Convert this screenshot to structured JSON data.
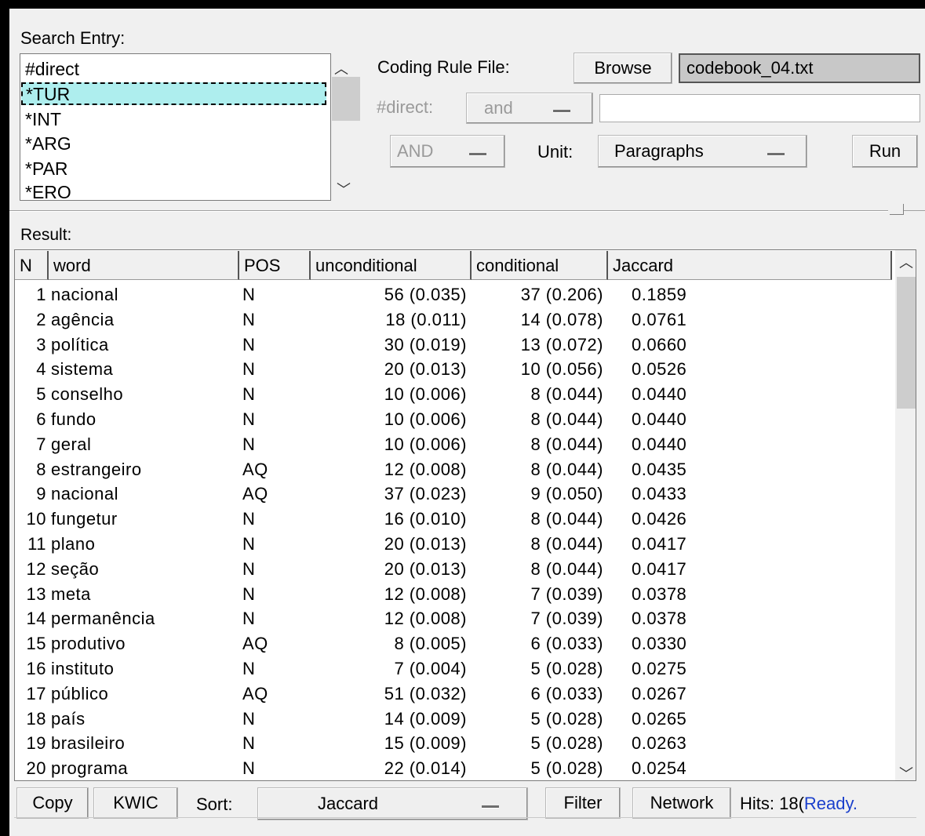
{
  "search": {
    "label": "Search Entry:",
    "entries": [
      "#direct",
      "*TUR",
      "*INT",
      "*ARG",
      "*PAR",
      "*ERO"
    ],
    "selected_index": 1
  },
  "coding": {
    "label": "Coding Rule File:",
    "browse_label": "Browse",
    "file_value": "codebook_04.txt"
  },
  "direct": {
    "label": "#direct:",
    "operator": "and",
    "value": ""
  },
  "options": {
    "logic": "AND",
    "unit_label": "Unit:",
    "unit_value": "Paragraphs",
    "run_label": "Run"
  },
  "result": {
    "label": "Result:",
    "columns": [
      "N",
      "word",
      "POS",
      "unconditional",
      "conditional",
      "Jaccard"
    ],
    "rows": [
      [
        "1",
        "nacional",
        "N",
        "56 (0.035)",
        "37 (0.206)",
        "0.1859"
      ],
      [
        "2",
        "agência",
        "N",
        "18 (0.011)",
        "14 (0.078)",
        "0.0761"
      ],
      [
        "3",
        "política",
        "N",
        "30 (0.019)",
        "13 (0.072)",
        "0.0660"
      ],
      [
        "4",
        "sistema",
        "N",
        "20 (0.013)",
        "10 (0.056)",
        "0.0526"
      ],
      [
        "5",
        "conselho",
        "N",
        "10 (0.006)",
        "8 (0.044)",
        "0.0440"
      ],
      [
        "6",
        "fundo",
        "N",
        "10 (0.006)",
        "8 (0.044)",
        "0.0440"
      ],
      [
        "7",
        "geral",
        "N",
        "10 (0.006)",
        "8 (0.044)",
        "0.0440"
      ],
      [
        "8",
        "estrangeiro",
        "AQ",
        "12 (0.008)",
        "8 (0.044)",
        "0.0435"
      ],
      [
        "9",
        "nacional",
        "AQ",
        "37 (0.023)",
        "9 (0.050)",
        "0.0433"
      ],
      [
        "10",
        "fungetur",
        "N",
        "16 (0.010)",
        "8 (0.044)",
        "0.0426"
      ],
      [
        "11",
        "plano",
        "N",
        "20 (0.013)",
        "8 (0.044)",
        "0.0417"
      ],
      [
        "12",
        "seção",
        "N",
        "20 (0.013)",
        "8 (0.044)",
        "0.0417"
      ],
      [
        "13",
        "meta",
        "N",
        "12 (0.008)",
        "7 (0.039)",
        "0.0378"
      ],
      [
        "14",
        "permanência",
        "N",
        "12 (0.008)",
        "7 (0.039)",
        "0.0378"
      ],
      [
        "15",
        "produtivo",
        "AQ",
        "8 (0.005)",
        "6 (0.033)",
        "0.0330"
      ],
      [
        "16",
        "instituto",
        "N",
        "7 (0.004)",
        "5 (0.028)",
        "0.0275"
      ],
      [
        "17",
        "público",
        "AQ",
        "51 (0.032)",
        "6 (0.033)",
        "0.0267"
      ],
      [
        "18",
        "país",
        "N",
        "14 (0.009)",
        "5 (0.028)",
        "0.0265"
      ],
      [
        "19",
        "brasileiro",
        "N",
        "15 (0.009)",
        "5 (0.028)",
        "0.0263"
      ],
      [
        "20",
        "programa",
        "N",
        "22 (0.014)",
        "5 (0.028)",
        "0.0254"
      ]
    ]
  },
  "footer": {
    "copy_label": "Copy",
    "kwic_label": "KWIC",
    "sort_label": "Sort:",
    "sort_value": "Jaccard",
    "filter_label": "Filter",
    "network_label": "Network",
    "hits_text": "Hits: 18(",
    "status": "Ready."
  },
  "icons": {
    "scroll_up": "chevron-up-icon",
    "scroll_down": "chevron-down-icon"
  },
  "colors": {
    "selection": "#aeeeee",
    "status_text": "#1a3fcc"
  }
}
